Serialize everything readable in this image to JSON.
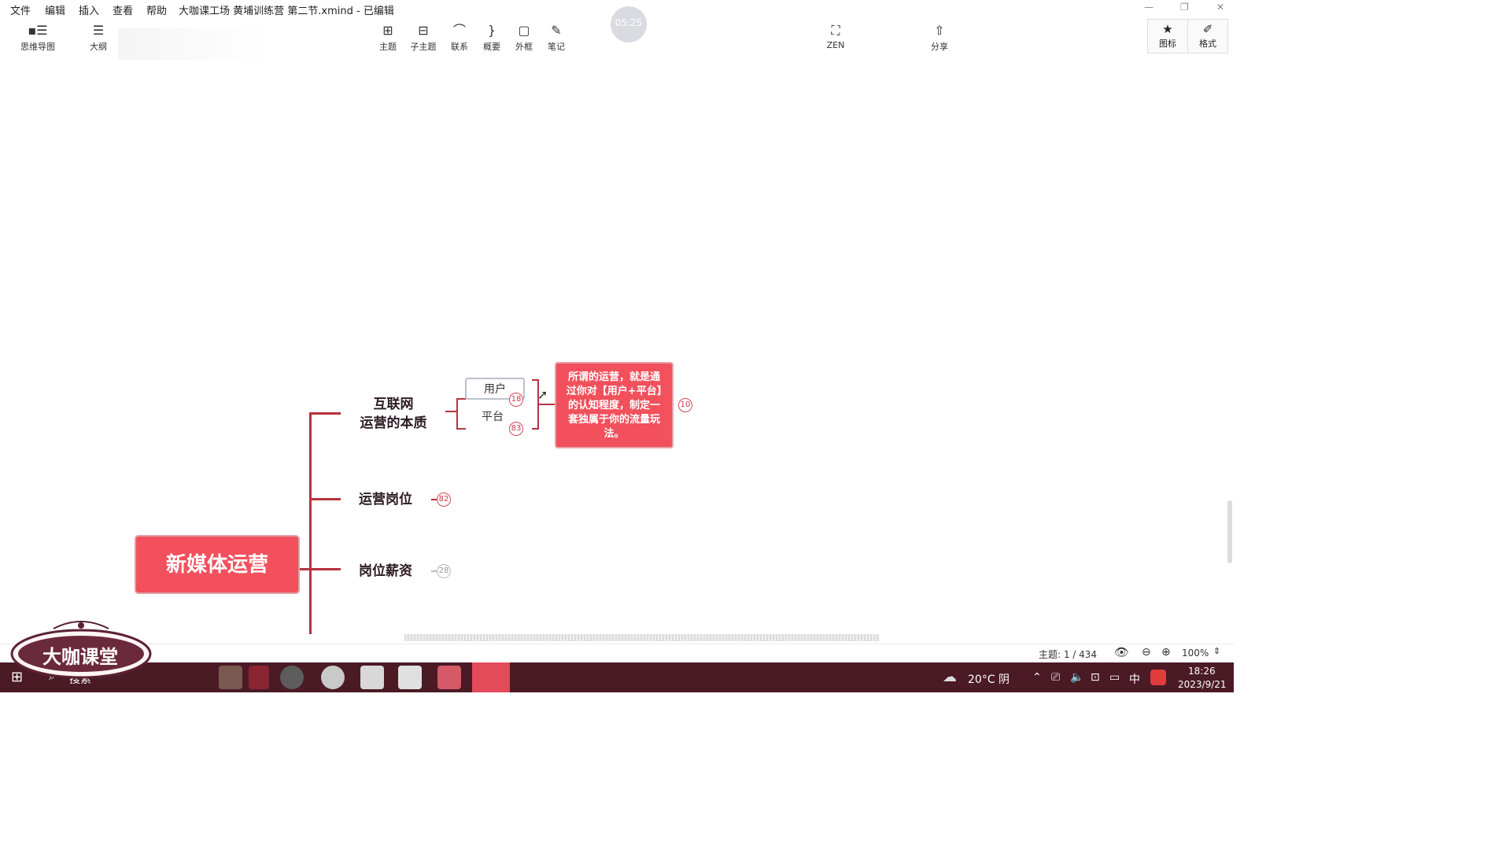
{
  "menu": [
    "文件",
    "编辑",
    "插入",
    "查看",
    "帮助"
  ],
  "window_title": "大咖课工场 黄埔训练营 第二节.xmind - 已编辑",
  "timer": "05:25",
  "toolbar": {
    "mindmap": "思维导图",
    "outline": "大纲",
    "topic": "主题",
    "subtopic": "子主题",
    "relation": "联系",
    "summary": "概要",
    "boundary": "外框",
    "note": "笔记",
    "zen": "ZEN",
    "share": "分享",
    "icons": "图标",
    "format": "格式"
  },
  "mindmap": {
    "root": "新媒体运营",
    "branch1_line1": "互联网",
    "branch1_line2": "运营的本质",
    "sub_user": "用户",
    "sub_platform": "平台",
    "badge_user": "18",
    "badge_platform": "83",
    "note_text": "所谓的运营，就是通过你对【用户+平台】的认知程度，制定一套独属于你的流量玩法。",
    "badge_note": "10",
    "branch2": "运营岗位",
    "badge_branch2": "82",
    "branch3": "岗位薪资",
    "badge_branch3": "28"
  },
  "statusbar": {
    "topic_count": "主题: 1 / 434",
    "zoom": "100%"
  },
  "taskbar": {
    "search": "搜索",
    "weather": "20°C 阴",
    "ime": "中",
    "time": "18:26",
    "date": "2023/9/21"
  },
  "watermark": "大咖课堂"
}
